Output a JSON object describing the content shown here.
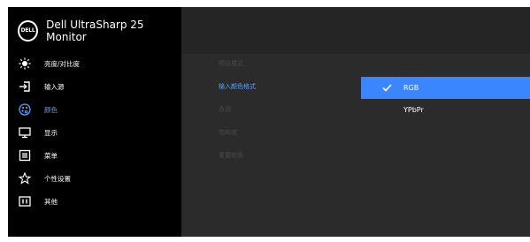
{
  "brand": {
    "logo_text": "DELL",
    "title": "Dell UltraSharp 25 Monitor"
  },
  "menu": [
    {
      "label": "亮度/对比度",
      "icon": "brightness-icon",
      "active": false
    },
    {
      "label": "输入源",
      "icon": "input-source-icon",
      "active": false
    },
    {
      "label": "颜色",
      "icon": "color-palette-icon",
      "active": true
    },
    {
      "label": "显示",
      "icon": "display-icon",
      "active": false
    },
    {
      "label": "菜单",
      "icon": "menu-icon",
      "active": false
    },
    {
      "label": "个性设置",
      "icon": "star-icon",
      "active": false
    },
    {
      "label": "其他",
      "icon": "other-info-icon",
      "active": false
    }
  ],
  "submenu": [
    {
      "label": "预设模式",
      "active": false
    },
    {
      "label": "输入颜色格式",
      "active": true
    },
    {
      "label": "色调",
      "active": false
    },
    {
      "label": "饱和度",
      "active": false
    },
    {
      "label": "重置颜色",
      "active": false
    }
  ],
  "options": [
    {
      "label": "RGB",
      "selected": true,
      "icon": "checkmark-icon"
    },
    {
      "label": "YPbPr",
      "selected": false
    }
  ],
  "colors": {
    "accent": "#3a86ff",
    "active_text": "#4ea4ff",
    "left_bg": "#000000",
    "right_bg": "#2b2b2b"
  }
}
